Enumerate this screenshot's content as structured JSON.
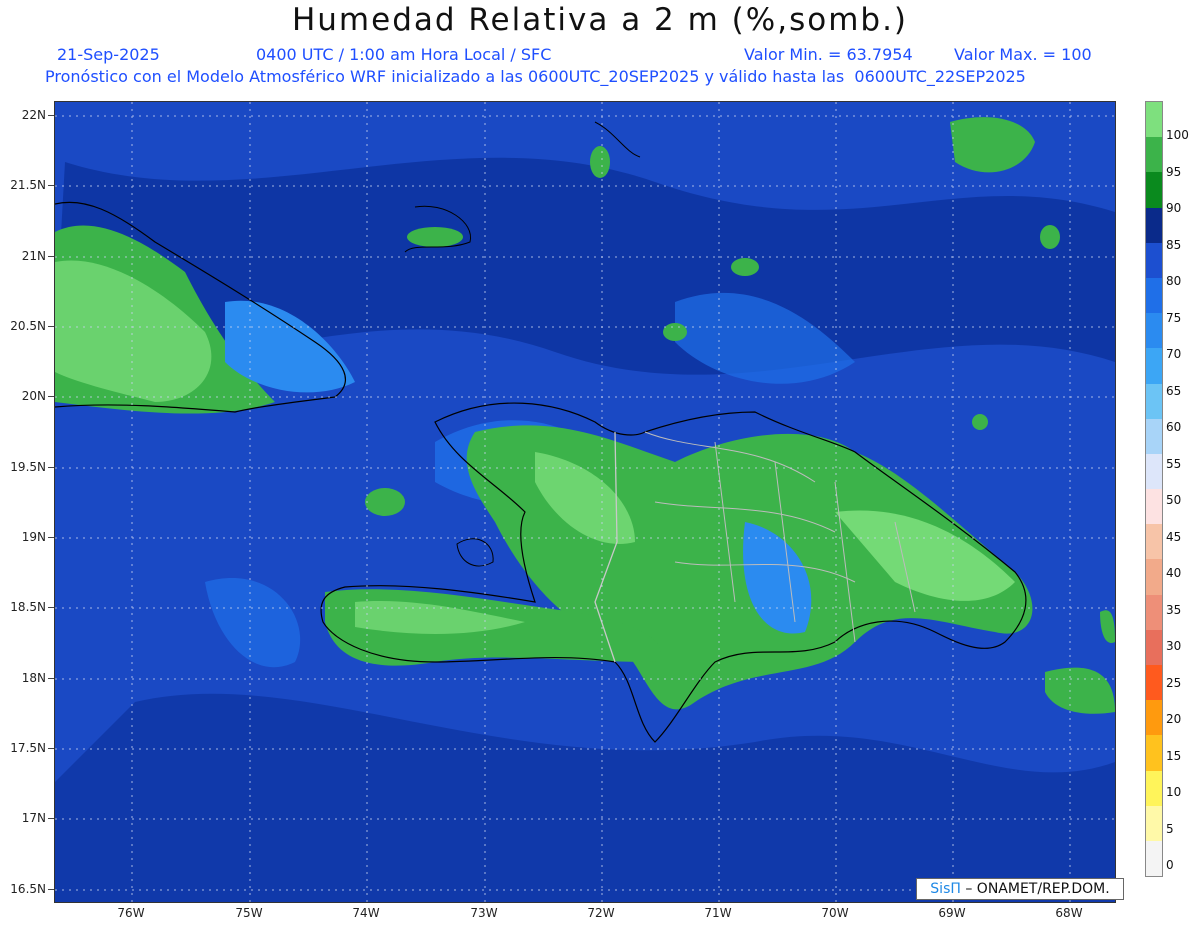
{
  "header": {
    "title": "Humedad Relativa a 2 m (%,somb.)",
    "date": "21-Sep-2025",
    "time": "0400 UTC / 1:00 am Hora Local / SFC",
    "min": "Valor Min. = 63.7954",
    "max": "Valor Max. = 100",
    "subtitle": "Pronóstico con el Modelo Atmosférico WRF inicializado a las 0600UTC_20SEP2025 y válido hasta las  0600UTC_22SEP2025"
  },
  "axes": {
    "lat_labels": [
      "22N",
      "21.5N",
      "21N",
      "20.5N",
      "20N",
      "19.5N",
      "19N",
      "18.5N",
      "18N",
      "17.5N",
      "17N",
      "16.5N"
    ],
    "lon_labels": [
      "76W",
      "75W",
      "74W",
      "73W",
      "72W",
      "71W",
      "70W",
      "69W",
      "68W"
    ]
  },
  "colorbar": {
    "labels": [
      "100",
      "95",
      "90",
      "85",
      "80",
      "75",
      "70",
      "65",
      "60",
      "55",
      "50",
      "45",
      "40",
      "35",
      "30",
      "25",
      "20",
      "15",
      "10",
      "5",
      "0"
    ],
    "colors": [
      "#7ee07e",
      "#3cb34a",
      "#0a8a1e",
      "#0a2a8a",
      "#1c4fd0",
      "#1f6fe8",
      "#2b8bf0",
      "#3ca6f5",
      "#6cc4f5",
      "#a8d4f8",
      "#dde6fa",
      "#fde2e2",
      "#f7c4a8",
      "#f2aa8a",
      "#ee8f78",
      "#e86f5c",
      "#ff5a1e",
      "#ff9a0e",
      "#ffc21e",
      "#fff45a",
      "#fff9a8",
      "#f4f4f4"
    ]
  },
  "credit": {
    "logo": "SisΠ",
    "text": " – ONAMET/REP.DOM."
  }
}
